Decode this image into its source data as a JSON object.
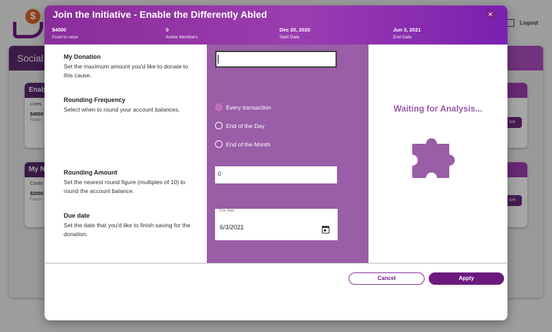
{
  "background": {
    "logo_symbol": "$",
    "logout_label": "Logout",
    "section_title_partial": "Social",
    "cards": [
      {
        "title": "Enabl",
        "text": "Lives",
        "value": "$4000",
        "sub": "Fund t"
      },
      {
        "title": "My Ne",
        "text": "Contri",
        "value": "$2000",
        "sub": "Fund t"
      }
    ],
    "give_label": "ive"
  },
  "modal": {
    "title": "Join the Initiative - Enable the Differently Abled",
    "close_glyph": "✕",
    "stats": [
      {
        "value": "$4000",
        "label": "Fund to raise"
      },
      {
        "value": "0",
        "label": "Active Members"
      },
      {
        "value": "Dec 20, 2020",
        "label": "Start Date"
      },
      {
        "value": "Jun 3, 2021",
        "label": "End Date"
      }
    ],
    "sections": {
      "donation": {
        "heading": "My Donation",
        "desc": "Set the maximum amount you'd like to donate to this cause.",
        "value": ""
      },
      "frequency": {
        "heading": "Rounding Frequency",
        "desc": "Select when to round your account balances.",
        "options": [
          "Every transaction",
          "End of the Day",
          "End of the Month"
        ],
        "selected": "Every transaction"
      },
      "amount": {
        "heading": "Rounding Amount",
        "desc": "Set the nearest round figure (multiples of 10) to round the account balance.",
        "value": "0"
      },
      "due": {
        "heading": "Due date",
        "desc": "Set the date that you'd like to finish saving for the donation.",
        "field_label": "Due date",
        "value": "6/3/2021"
      }
    },
    "analysis": {
      "text": "Waiting for Analysis...",
      "icon": "puzzle-icon"
    },
    "buttons": {
      "cancel": "Cancel",
      "apply": "Apply"
    }
  },
  "colors": {
    "accent": "#8a2c9a",
    "panel": "#9a5da8",
    "primary_button": "#6d1a80"
  }
}
